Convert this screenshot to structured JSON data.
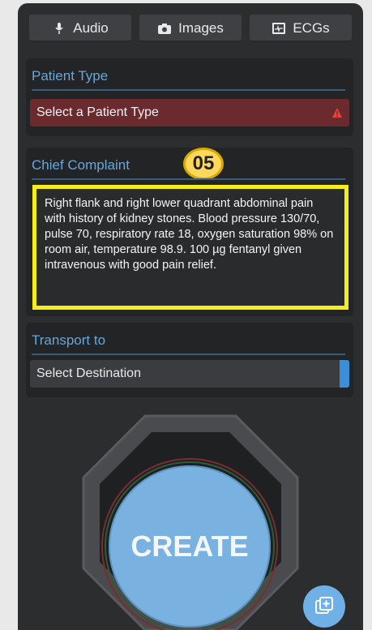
{
  "tabs": [
    {
      "label": "Audio",
      "icon": "microphone-icon"
    },
    {
      "label": "Images",
      "icon": "camera-icon"
    },
    {
      "label": "ECGs",
      "icon": "ecg-icon"
    }
  ],
  "patient_type": {
    "title": "Patient Type",
    "placeholder": "Select a Patient Type",
    "status_icon": "warning-icon"
  },
  "chief_complaint": {
    "title": "Chief Complaint",
    "step": "05",
    "text": "Right flank and right lower quadrant abdominal pain with history of kidney stones. Blood pressure 130/70, pulse 70, respiratory rate 18, oxygen saturation 98% on room air, temperature 98.9. 100 µg fentanyl given intravenous with good pain relief."
  },
  "transport": {
    "title": "Transport to",
    "placeholder": "Select Destination"
  },
  "create": {
    "label": "CREATE"
  },
  "fab": {
    "icon": "add-copy-icon"
  },
  "colors": {
    "accent": "#6aa6d6",
    "warning_bg": "#6a2a2e",
    "highlight": "#f6ee1a",
    "create": "#79b2e0"
  }
}
